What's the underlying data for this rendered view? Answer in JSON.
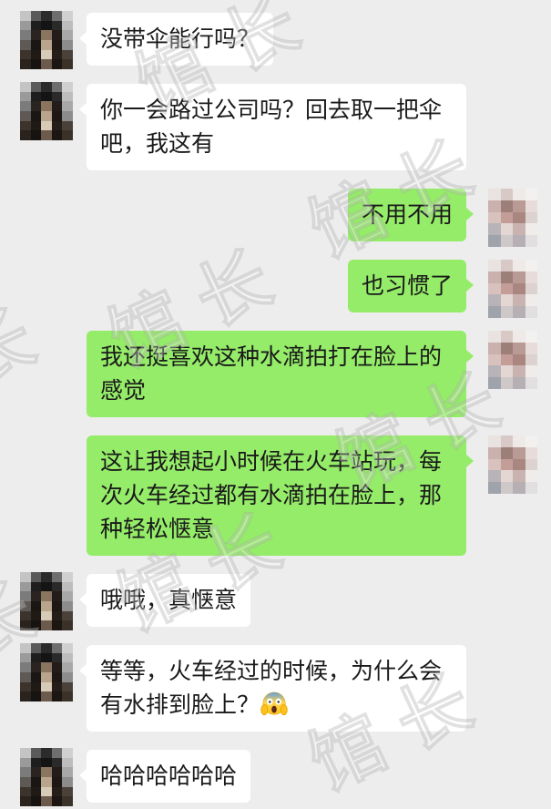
{
  "colors": {
    "background": "#ededed",
    "incoming_bubble": "#ffffff",
    "outgoing_bubble": "#95ec69"
  },
  "chat": {
    "messages": [
      {
        "from_me": false,
        "text": "没带伞能行吗？"
      },
      {
        "from_me": false,
        "text": "你一会路过公司吗？回去取一把伞吧，我这有"
      },
      {
        "from_me": true,
        "text": "不用不用"
      },
      {
        "from_me": true,
        "text": "也习惯了"
      },
      {
        "from_me": true,
        "text": "我还挺喜欢这种水滴拍打在脸上的感觉"
      },
      {
        "from_me": true,
        "text": "这让我想起小时候在火车站玩，每次火车经过都有水滴拍在脸上，那种轻松惬意"
      },
      {
        "from_me": false,
        "text": "哦哦，真惬意"
      },
      {
        "from_me": false,
        "text": "等等，火车经过的时候，为什么会有水排到脸上？",
        "emoji_icon": "face-screaming-in-fear-icon"
      },
      {
        "from_me": false,
        "text": "哈哈哈哈哈哈"
      }
    ]
  },
  "watermark": {
    "text": "馆长"
  }
}
